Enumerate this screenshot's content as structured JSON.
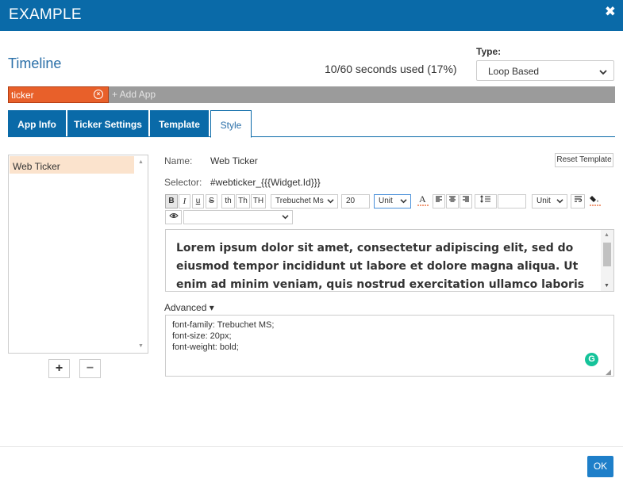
{
  "dialog": {
    "title": "EXAMPLE",
    "close_glyph": "✖"
  },
  "timeline": {
    "title": "Timeline",
    "seconds_used": "10/60 seconds used (17%)",
    "type_label": "Type:",
    "type_value": "Loop Based"
  },
  "apps": {
    "chips": [
      {
        "label": "ticker",
        "remove_glyph": "×"
      }
    ],
    "add_label": "+ Add App"
  },
  "tabs": [
    {
      "label": "App Info"
    },
    {
      "label": "Ticker Settings"
    },
    {
      "label": "Template"
    },
    {
      "label": "Style",
      "active": true
    }
  ],
  "widget_list": {
    "items": [
      "Web Ticker"
    ],
    "add_glyph": "+",
    "remove_glyph": "−"
  },
  "style": {
    "name_label": "Name:",
    "name_value": "Web Ticker",
    "selector_label": "Selector:",
    "selector_value": "#webticker_{{{Widget.Id}}}",
    "reset_label": "Reset Template",
    "toolbar": {
      "bold": "B",
      "italic": "I",
      "underline": "u",
      "strike": "S",
      "lower_th": "th",
      "title_th": "Th",
      "upper_th": "TH",
      "font_family": "Trebuchet Ms",
      "font_size": "20",
      "unit": "Unit",
      "unit2": "Unit",
      "line_height_value": "",
      "visibility_value": ""
    },
    "preview_text": "Lorem ipsum dolor sit amet, consectetur adipiscing elit, sed do eiusmod tempor incididunt ut labore et dolore magna aliqua. Ut enim ad minim veniam, quis nostrud exercitation ullamco laboris nisi ut",
    "advanced_label": "Advanced ▾",
    "css_lines": [
      "font-family: Trebuchet MS;",
      "font-size: 20px;",
      "font-weight: bold;"
    ]
  },
  "footer": {
    "ok_label": "OK"
  },
  "colors": {
    "header_blue": "#0a6aa8",
    "title_blue": "#2a6fa8",
    "chip_orange": "#e8602a",
    "list_selected": "#fbe3cd",
    "ok_blue": "#1e7fc9",
    "grammarly_green": "#15c39a"
  }
}
